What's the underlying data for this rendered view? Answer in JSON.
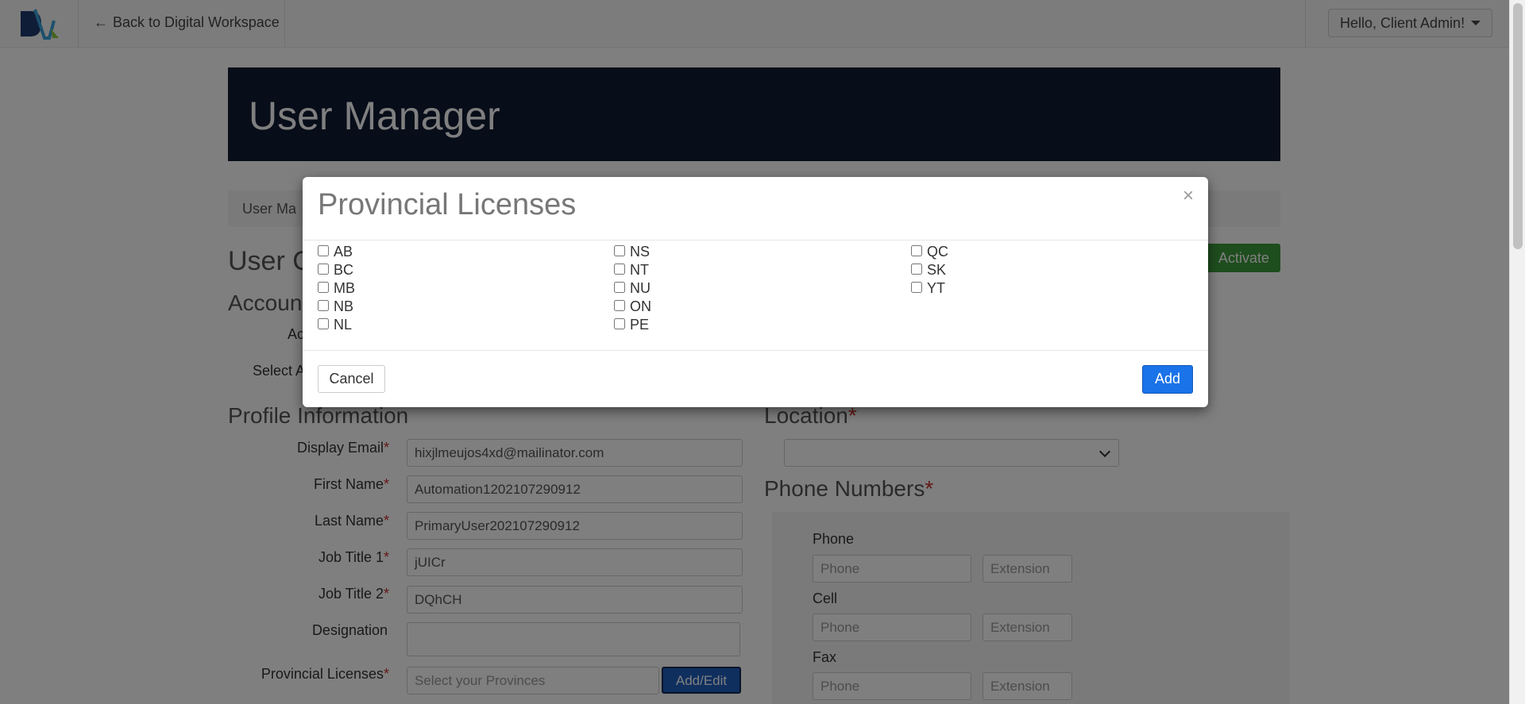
{
  "nav": {
    "back_label": "Back to Digital Workspace",
    "user_greeting": "Hello, Client Admin!"
  },
  "page": {
    "title": "User Manager",
    "breadcrumb": "User Ma",
    "user_heading": "User C",
    "account_heading": "Accoun",
    "activate_label": "Activate",
    "account_label_1": "Ac",
    "account_label_2": "Select A",
    "profile_heading": "Profile Information",
    "location_heading": "Location",
    "phone_heading": "Phone Numbers"
  },
  "form": {
    "display_email_label": "Display Email",
    "display_email_value": "hixjlmeujos4xd@mailinator.com",
    "first_name_label": "First Name",
    "first_name_value": "Automation1202107290912",
    "last_name_label": "Last Name",
    "last_name_value": "PrimaryUser202107290912",
    "job_title1_label": "Job Title 1",
    "job_title1_value": "jUICr",
    "job_title2_label": "Job Title 2",
    "job_title2_value": "DQhCH",
    "designation_label": "Designation",
    "designation_value": "",
    "provincial_label": "Provincial Licenses",
    "provincial_placeholder": "Select your Provinces",
    "addedit_label": "Add/Edit"
  },
  "phones": {
    "phone_label": "Phone",
    "cell_label": "Cell",
    "fax_label": "Fax",
    "phone_placeholder": "Phone",
    "extension_placeholder": "Extension"
  },
  "modal": {
    "title": "Provincial Licenses",
    "close": "×",
    "cancel_label": "Cancel",
    "add_label": "Add",
    "col1": [
      "AB",
      "BC",
      "MB",
      "NB",
      "NL"
    ],
    "col2": [
      "NS",
      "NT",
      "NU",
      "ON",
      "PE"
    ],
    "col3": [
      "QC",
      "SK",
      "YT"
    ]
  }
}
